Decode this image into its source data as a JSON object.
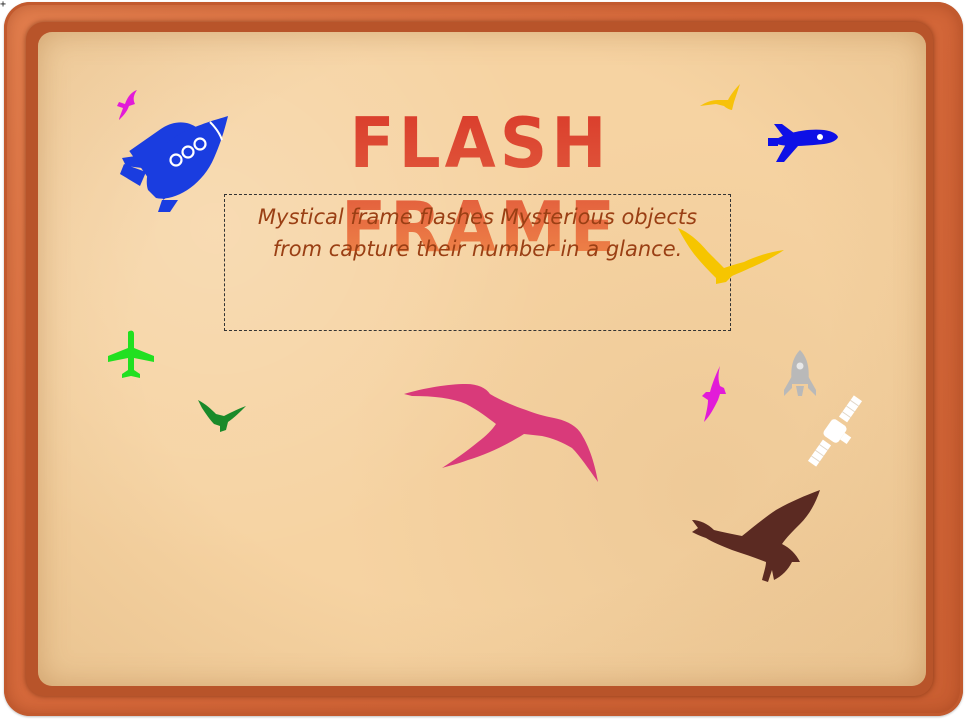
{
  "game": {
    "title": "FLASH FRAME",
    "description_line1": "Mystical frame flashes Mysterious objects",
    "description_line2": "from capture their number in a glance."
  },
  "objects": [
    {
      "icon": "rocket-icon",
      "color": "#1a3de0"
    },
    {
      "icon": "rocket-icon",
      "color": "#0e10e6"
    },
    {
      "icon": "rocket-icon",
      "color": "#b9b9b9"
    },
    {
      "icon": "bird-icon",
      "color": "#e21bd8"
    },
    {
      "icon": "bird-icon",
      "color": "#f7c20a"
    },
    {
      "icon": "bird-icon",
      "color": "#f6c500"
    },
    {
      "icon": "bird-icon",
      "color": "#1a8a2a"
    },
    {
      "icon": "bird-icon",
      "color": "#d93a7a"
    },
    {
      "icon": "bird-icon",
      "color": "#e21bd8"
    },
    {
      "icon": "bird-icon",
      "color": "#5b2a22"
    },
    {
      "icon": "airplane-icon",
      "color": "#21e021"
    },
    {
      "icon": "satellite-icon",
      "color": "#ffffff"
    }
  ],
  "colors": {
    "frame": "#d5683a",
    "paper": "#f6d3a2",
    "title_top": "#d93a2a",
    "title_bottom": "#f08a4a",
    "description": "#9a3f14"
  }
}
